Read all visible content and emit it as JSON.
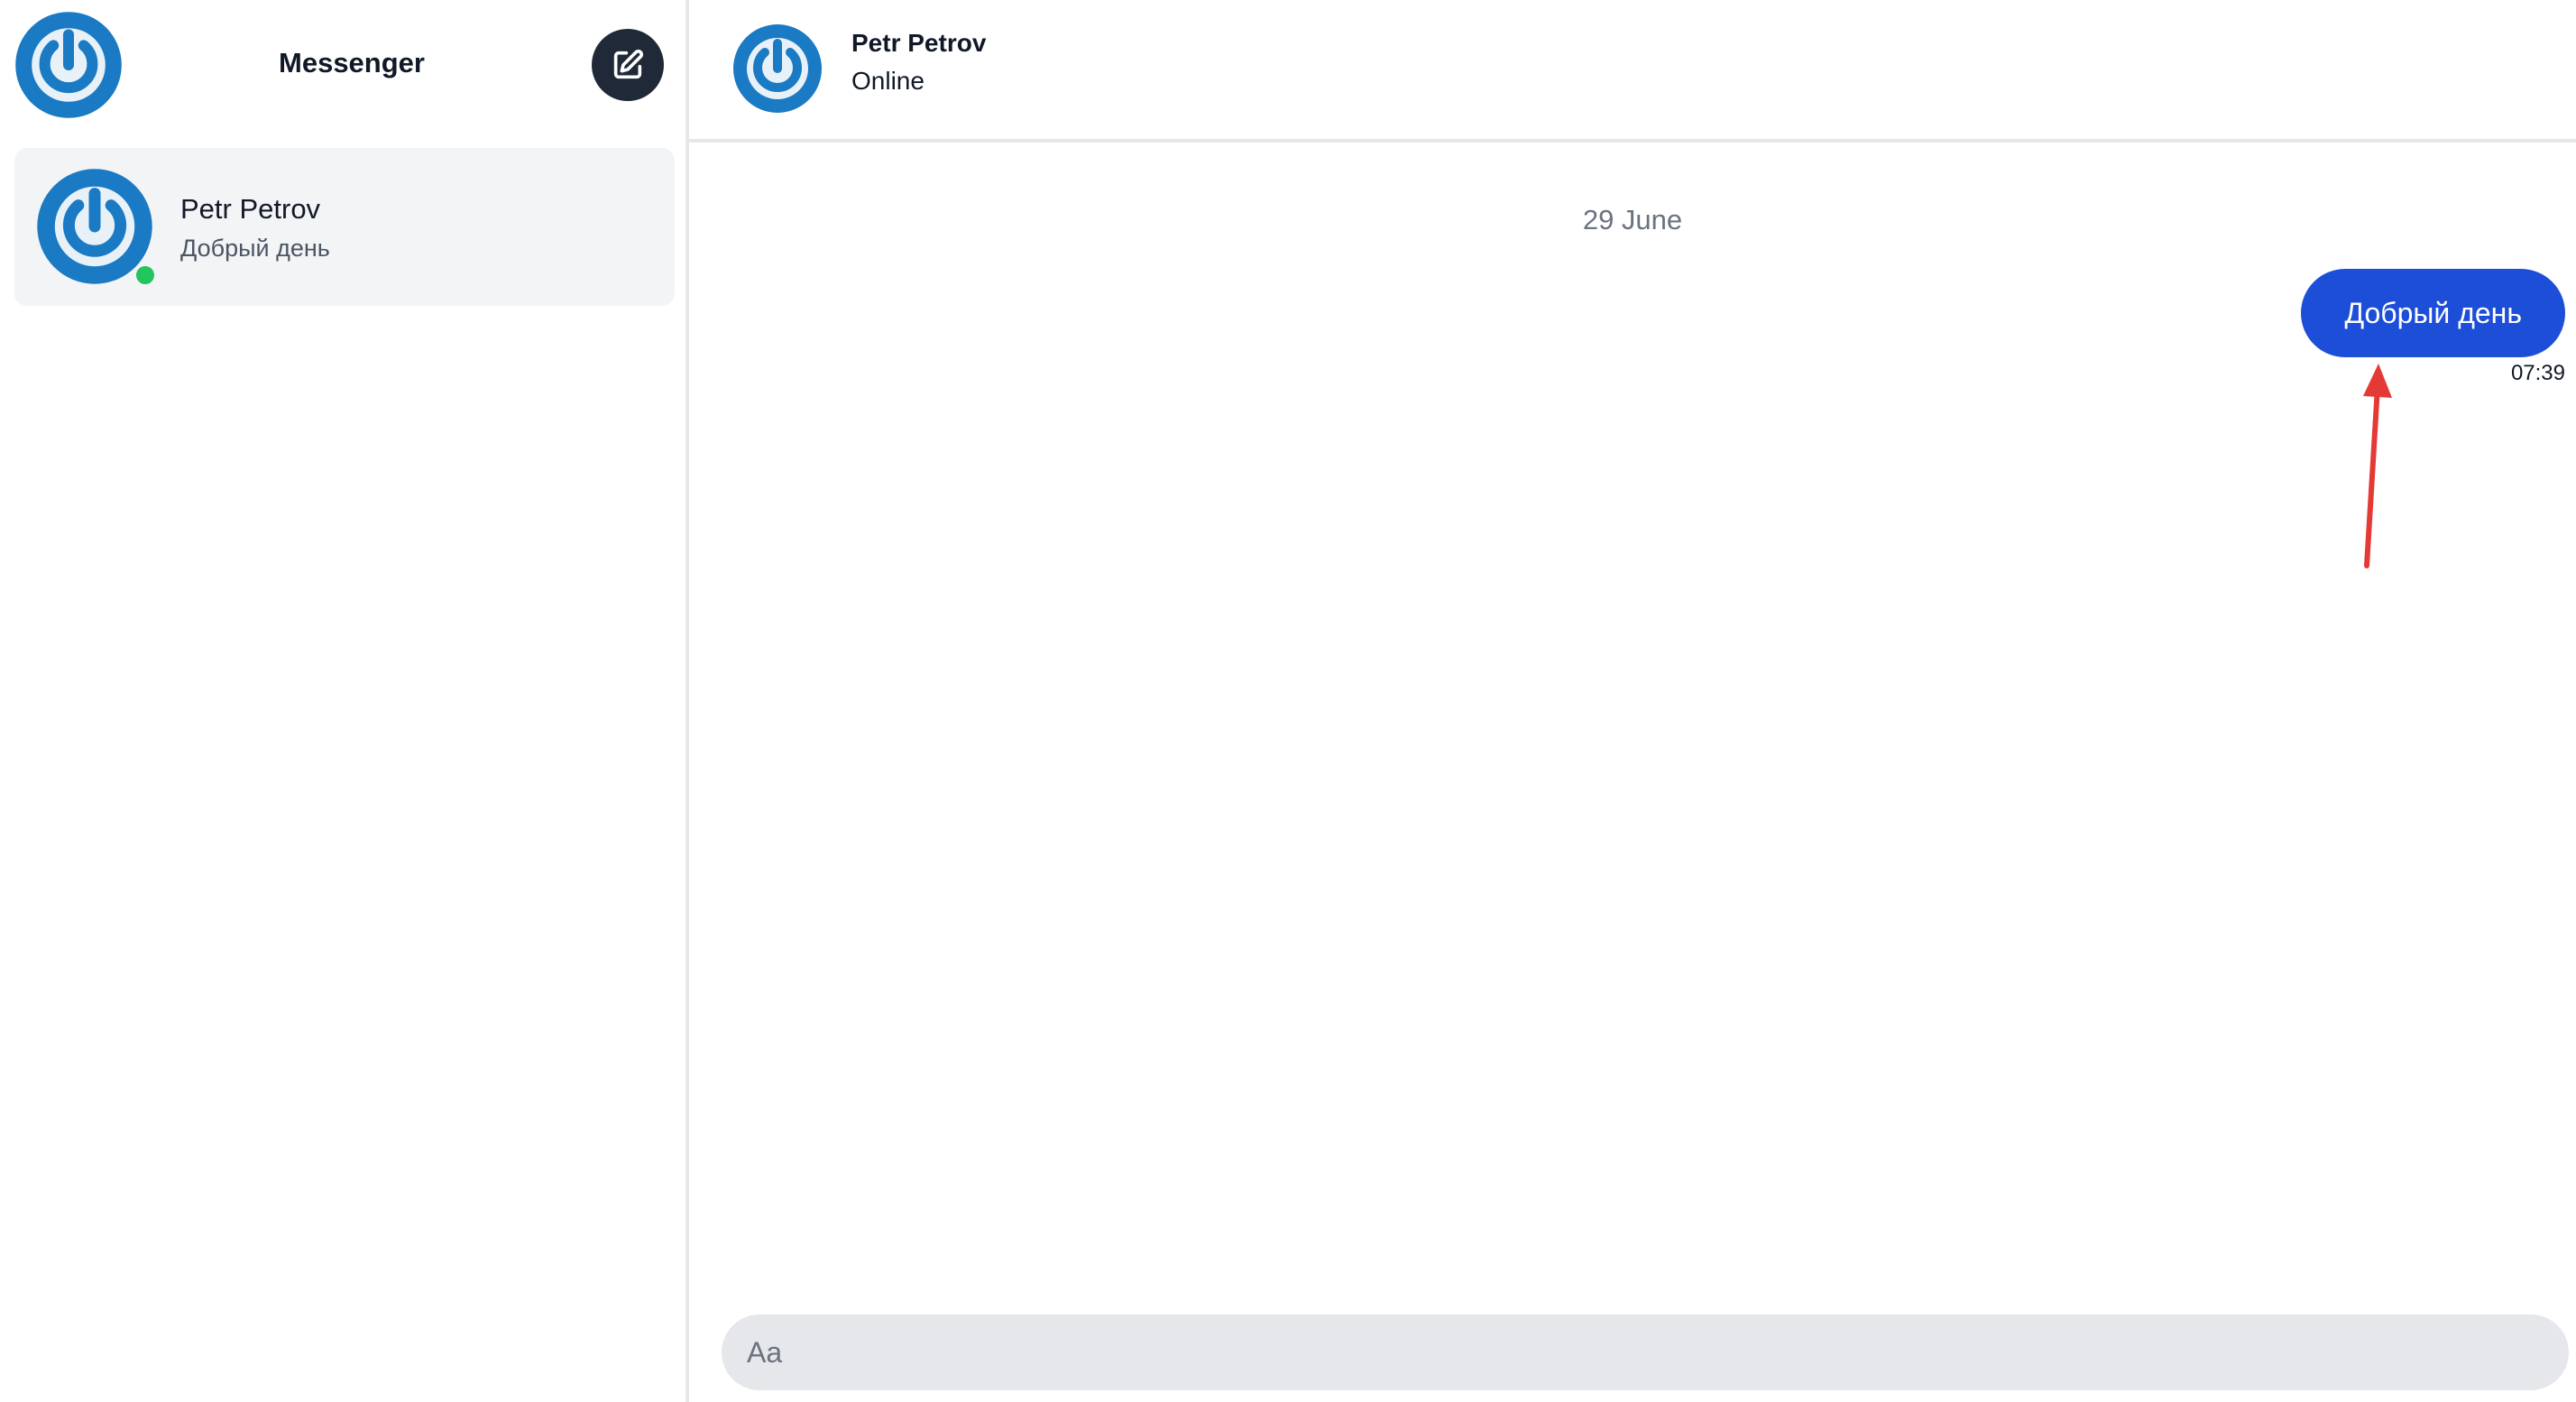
{
  "sidebar": {
    "logo_icon": "power-icon",
    "title": "Messenger",
    "compose_icon": "edit-icon",
    "conversations": [
      {
        "avatar_icon": "power-icon",
        "name": "Petr Petrov",
        "preview": "Добрый день",
        "online": true
      }
    ]
  },
  "chat": {
    "header": {
      "avatar_icon": "power-icon",
      "name": "Petr Petrov",
      "status": "Online"
    },
    "date_divider": "29 June",
    "messages": [
      {
        "text": "Добрый день",
        "time": "07:39",
        "outgoing": true
      }
    ],
    "composer": {
      "placeholder": "Aa"
    }
  },
  "colors": {
    "accent": "#1d4ed8",
    "avatar_blue": "#1a7ac4",
    "online_green": "#22c55e",
    "compose_button": "#1f2937",
    "conversation_bg": "#f3f4f6",
    "composer_bg": "#e5e7eb",
    "annotation_arrow": "#e53935"
  }
}
